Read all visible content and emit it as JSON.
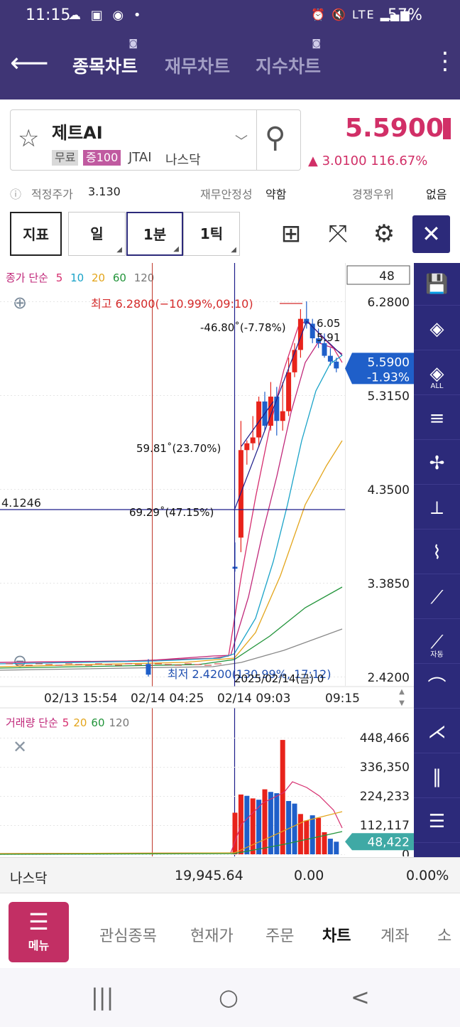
{
  "status_bar": {
    "time": "11:15",
    "left_icons": "☁ ▣ ◉ •",
    "right_icons": "⏰ 🔇 LTE ▂▄▆",
    "battery": "57%"
  },
  "header": {
    "back_icon": "arrow-left-icon",
    "tabs": [
      {
        "label": "종목차트",
        "active": true
      },
      {
        "label": "재무차트",
        "active": false
      },
      {
        "label": "지수차트",
        "active": false
      }
    ],
    "more_icon": "more-vertical-icon"
  },
  "stock": {
    "name": "제트AI",
    "badge_free": "무료",
    "badge_margin": "증100",
    "ticker": "JTAI",
    "exchange": "나스닥",
    "price": "5.5900",
    "change": "▲ 3.0100  116.67%"
  },
  "info": {
    "fair_price_label": "적정주가",
    "fair_price_value": "3.130",
    "stability_label": "재무안정성",
    "stability_value": "약함",
    "competition_label": "경쟁우위",
    "competition_value": "없음"
  },
  "toolbar": {
    "indicator": "지표",
    "period_day": "일",
    "period_1min": "1분",
    "period_1tick": "1틱"
  },
  "chart_data": {
    "type": "candlestick",
    "legend_price": {
      "prefix": "종가 단순",
      "ma": [
        "5",
        "10",
        "20",
        "60",
        "120"
      ]
    },
    "legend_volume": {
      "prefix": "거래량 단순",
      "ma": [
        "5",
        "20",
        "60",
        "120"
      ]
    },
    "visible_count": "48",
    "y_ticks": [
      "6.2800",
      "5.3150",
      "4.3500",
      "3.3850",
      "2.4200"
    ],
    "ylim": [
      2.42,
      6.28
    ],
    "x_ticks": [
      "02/13 15:54",
      "02/14 04:25",
      "02/14 09:03",
      "09:15"
    ],
    "current_price_tag": "5.5900",
    "current_change_tag": "-1.93%",
    "crosshair_price": "4.1246",
    "annotation_high": "최고 6.2800(−10.99%,09:10)",
    "annotation_low": "최저 2.4200(130.99%, 17:12)",
    "annotation_date": "2025/02/14(금) 0",
    "angle_labels": [
      "-46.80˚(-7.78%)",
      "59.81˚(23.70%)",
      "69.29˚(47.15%)"
    ],
    "price_labels": [
      "6.05",
      "5.91"
    ],
    "candles": [
      {
        "o": 2.55,
        "h": 2.6,
        "l": 2.42,
        "c": 2.44
      },
      {
        "o": 3.55,
        "h": 3.8,
        "l": 3.5,
        "c": 3.53
      },
      {
        "o": 3.85,
        "h": 5.05,
        "l": 3.7,
        "c": 4.75
      },
      {
        "o": 4.75,
        "h": 4.85,
        "l": 4.6,
        "c": 4.82
      },
      {
        "o": 4.82,
        "h": 5.1,
        "l": 4.75,
        "c": 4.88
      },
      {
        "o": 4.88,
        "h": 5.3,
        "l": 4.78,
        "c": 5.25
      },
      {
        "o": 5.25,
        "h": 5.35,
        "l": 4.95,
        "c": 5.0
      },
      {
        "o": 5.0,
        "h": 5.45,
        "l": 4.95,
        "c": 5.3
      },
      {
        "o": 5.3,
        "h": 5.4,
        "l": 4.9,
        "c": 5.05
      },
      {
        "o": 5.05,
        "h": 5.45,
        "l": 4.95,
        "c": 5.15
      },
      {
        "o": 5.15,
        "h": 5.7,
        "l": 5.1,
        "c": 5.55
      },
      {
        "o": 5.55,
        "h": 5.85,
        "l": 5.5,
        "c": 5.78
      },
      {
        "o": 5.78,
        "h": 6.2,
        "l": 5.7,
        "c": 6.1
      },
      {
        "o": 6.1,
        "h": 6.28,
        "l": 6.0,
        "c": 6.05
      },
      {
        "o": 6.05,
        "h": 6.1,
        "l": 5.85,
        "c": 5.9
      },
      {
        "o": 5.9,
        "h": 6.0,
        "l": 5.8,
        "c": 5.85
      },
      {
        "o": 5.85,
        "h": 5.95,
        "l": 5.7,
        "c": 5.72
      },
      {
        "o": 5.72,
        "h": 5.8,
        "l": 5.62,
        "c": 5.66
      },
      {
        "o": 5.66,
        "h": 5.7,
        "l": 5.55,
        "c": 5.59
      }
    ],
    "volume_ticks": [
      "448,466",
      "336,350",
      "224,233",
      "112,117",
      "0"
    ],
    "volume_max": 448466,
    "current_volume_tag": "48,422",
    "volumes": [
      {
        "v": 5000,
        "up": false
      },
      {
        "v": 160000,
        "up": true
      },
      {
        "v": 230000,
        "up": true
      },
      {
        "v": 225000,
        "up": false
      },
      {
        "v": 215000,
        "up": true
      },
      {
        "v": 210000,
        "up": false
      },
      {
        "v": 250000,
        "up": true
      },
      {
        "v": 240000,
        "up": false
      },
      {
        "v": 235000,
        "up": false
      },
      {
        "v": 440000,
        "up": true
      },
      {
        "v": 205000,
        "up": false
      },
      {
        "v": 195000,
        "up": false
      },
      {
        "v": 155000,
        "up": true
      },
      {
        "v": 130000,
        "up": true
      },
      {
        "v": 150000,
        "up": false
      },
      {
        "v": 140000,
        "up": true
      },
      {
        "v": 85000,
        "up": true
      },
      {
        "v": 60000,
        "up": false
      },
      {
        "v": 48422,
        "up": false
      }
    ]
  },
  "colors": {
    "header_bg": "#3f3575",
    "up": "#e8231b",
    "down": "#1f5fc9",
    "accent": "#d12f67",
    "toolbar_dark": "#2c2a7a"
  },
  "index_row": {
    "name": "나스닥",
    "value": "19,945.64",
    "change": "0.00",
    "pct": "0.00%"
  },
  "bottom_nav": {
    "menu_label": "메뉴",
    "items": [
      {
        "label": "관심종목",
        "active": false
      },
      {
        "label": "현재가",
        "active": false
      },
      {
        "label": "주문",
        "active": false
      },
      {
        "label": "차트",
        "active": true
      },
      {
        "label": "계좌",
        "active": false
      },
      {
        "label": "소",
        "active": false
      }
    ]
  },
  "system_nav": {
    "recent": "|||",
    "home": "○",
    "back": "<"
  }
}
